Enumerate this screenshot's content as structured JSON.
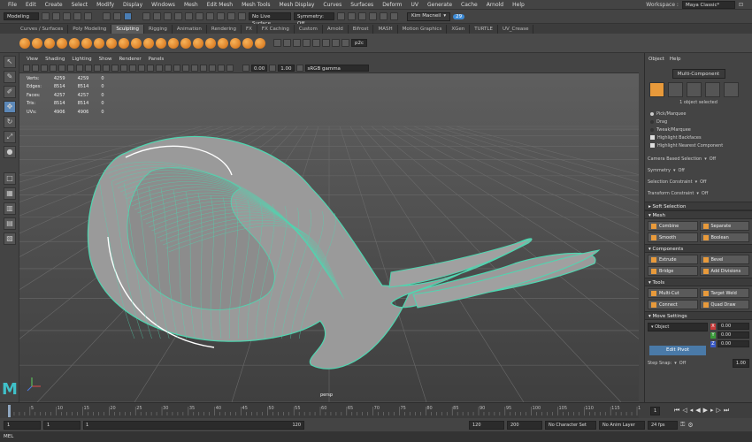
{
  "menubar": {
    "items": [
      "File",
      "Edit",
      "Create",
      "Select",
      "Modify",
      "Display",
      "Windows",
      "Mesh",
      "Edit Mesh",
      "Mesh Tools",
      "Mesh Display",
      "Curves",
      "Surfaces",
      "Deform",
      "UV",
      "Generate",
      "Cache",
      "Arnold",
      "Help"
    ],
    "workspace_label": "Workspace :",
    "workspace_value": "Maya Classic*"
  },
  "statusline": {
    "mode": "Modeling",
    "live_surface": "No Live Surface",
    "symmetry": "Symmetry: Off",
    "user": "Kim Macneil",
    "notifications": "29"
  },
  "shelf": {
    "tabs": [
      "Curves / Surfaces",
      "Poly Modeling",
      "Sculpting",
      "Rigging",
      "Animation",
      "Rendering",
      "FX",
      "FX Caching",
      "Custom",
      "Arnold",
      "Bifrost",
      "MASH",
      "Motion Graphics",
      "XGen",
      "TURTLE",
      "UV_Crease"
    ],
    "active_tab": "Sculpting",
    "tool_count_a": 20,
    "tool_count_b": 8,
    "extra_label": "p2c"
  },
  "viewport": {
    "menu": [
      "View",
      "Shading",
      "Lighting",
      "Show",
      "Renderer",
      "Panels"
    ],
    "exposure": "0.00",
    "gamma": "1.00",
    "colorspace": "sRGB gamma",
    "camera": "persp",
    "hud": [
      {
        "label": "Verts:",
        "a": "4259",
        "b": "4259",
        "c": "0"
      },
      {
        "label": "Edges:",
        "a": "8514",
        "b": "8514",
        "c": "0"
      },
      {
        "label": "Faces:",
        "a": "4257",
        "b": "4257",
        "c": "0"
      },
      {
        "label": "Tris:",
        "a": "8514",
        "b": "8514",
        "c": "0"
      },
      {
        "label": "UVs:",
        "a": "4906",
        "b": "4906",
        "c": "0"
      }
    ]
  },
  "rightpanel": {
    "menu": [
      "Object",
      "Help"
    ],
    "multi_component": "Multi-Component",
    "selected_count": "1 object selected",
    "pick_marquee": "Pick/Marquee",
    "drag": "Drag",
    "tweak_marquee": "Tweak/Marquee",
    "highlight_backfaces": "Highlight Backfaces",
    "highlight_nearest": "Highlight Nearest Component",
    "camera_based_selection": "Camera Based Selection",
    "camera_based_value": "Off",
    "symmetry": "Symmetry",
    "symmetry_value": "Off",
    "selection_constraint": "Selection Constraint",
    "selection_constraint_value": "Off",
    "transform_constraint": "Transform Constraint",
    "transform_constraint_value": "Off",
    "soft_selection": "Soft Selection",
    "sections": {
      "mesh": "Mesh",
      "components": "Components",
      "tools": "Tools",
      "move_settings": "Move Settings"
    },
    "mesh_buttons": [
      "Combine",
      "Separate",
      "Smooth",
      "Boolean"
    ],
    "component_buttons": [
      "Extrude",
      "Bevel",
      "Bridge",
      "Add Divisions"
    ],
    "tool_buttons": [
      "Multi-Cut",
      "Target Weld",
      "Connect",
      "Quad Draw"
    ],
    "move_space": "Object",
    "x_value": "0.00",
    "y_value": "0.00",
    "z_value": "0.00",
    "edit_pivot": "Edit Pivot",
    "step_snap": "Step Snap:",
    "step_snap_value": "Off",
    "step_value": "1.00"
  },
  "timeline": {
    "ticks": [
      "5",
      "10",
      "15",
      "20",
      "25",
      "30",
      "35",
      "40",
      "45",
      "50",
      "55",
      "60",
      "65",
      "70",
      "75",
      "80",
      "85",
      "90",
      "95",
      "100",
      "105",
      "110",
      "115",
      "1"
    ],
    "current_frame": "1"
  },
  "range": {
    "start": "1",
    "inner_start": "1",
    "range_end_label": "1",
    "inner_end": "120",
    "end": "120",
    "max": "200",
    "character_set": "No Character Set",
    "anim_layer": "No Anim Layer",
    "fps": "24 fps"
  },
  "cmdline": {
    "label": "MEL"
  },
  "logo": {
    "text": "M"
  }
}
